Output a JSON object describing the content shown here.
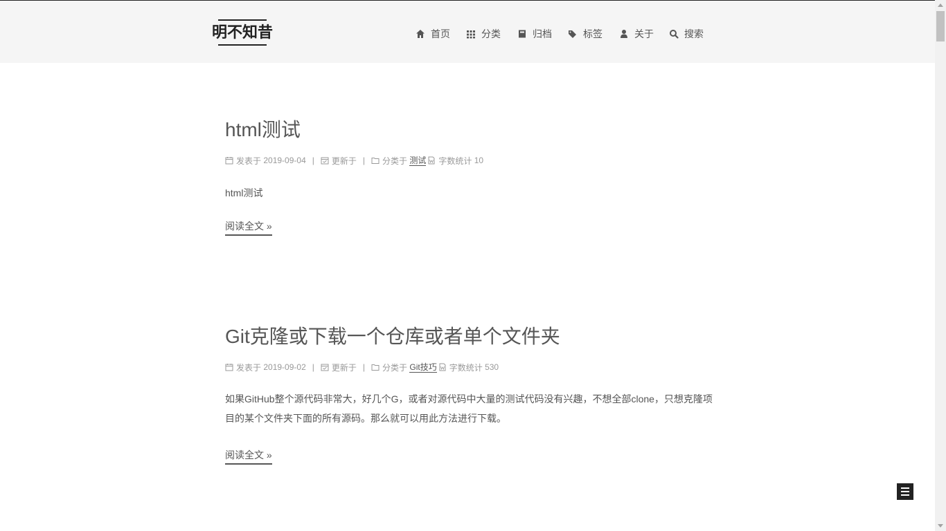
{
  "site": {
    "title": "明不知昔"
  },
  "nav": {
    "items": [
      {
        "label": "首页",
        "icon": "home-icon"
      },
      {
        "label": "分类",
        "icon": "grid-icon"
      },
      {
        "label": "归档",
        "icon": "archive-icon"
      },
      {
        "label": "标签",
        "icon": "tags-icon"
      },
      {
        "label": "关于",
        "icon": "user-icon"
      },
      {
        "label": "搜索",
        "icon": "search-icon"
      }
    ]
  },
  "posts": [
    {
      "title": "html测试",
      "posted_label": "发表于",
      "posted_date": "2019-09-04",
      "updated_label": "更新于",
      "category_label": "分类于",
      "category": "测试",
      "wordcount_label": "字数统计",
      "wordcount": "10",
      "excerpt": "html测试",
      "readmore": "阅读全文 »"
    },
    {
      "title": "Git克隆或下载一个仓库或者单个文件夹",
      "posted_label": "发表于",
      "posted_date": "2019-09-02",
      "updated_label": "更新于",
      "category_label": "分类于",
      "category": "Git技巧",
      "wordcount_label": "字数统计",
      "wordcount": "530",
      "excerpt": "如果GitHub整个源代码非常大，好几个G，或者对源代码中大量的测试代码没有兴趣，不想全部clone，只想克隆项目的某个文件夹下面的所有源码。那么就可以用此方法进行下载。",
      "readmore": "阅读全文 »"
    }
  ],
  "meta_separator": "|",
  "colors": {
    "header_bg": "#f5f5f5",
    "text": "#555555",
    "meta": "#999999",
    "brand": "#222222"
  }
}
